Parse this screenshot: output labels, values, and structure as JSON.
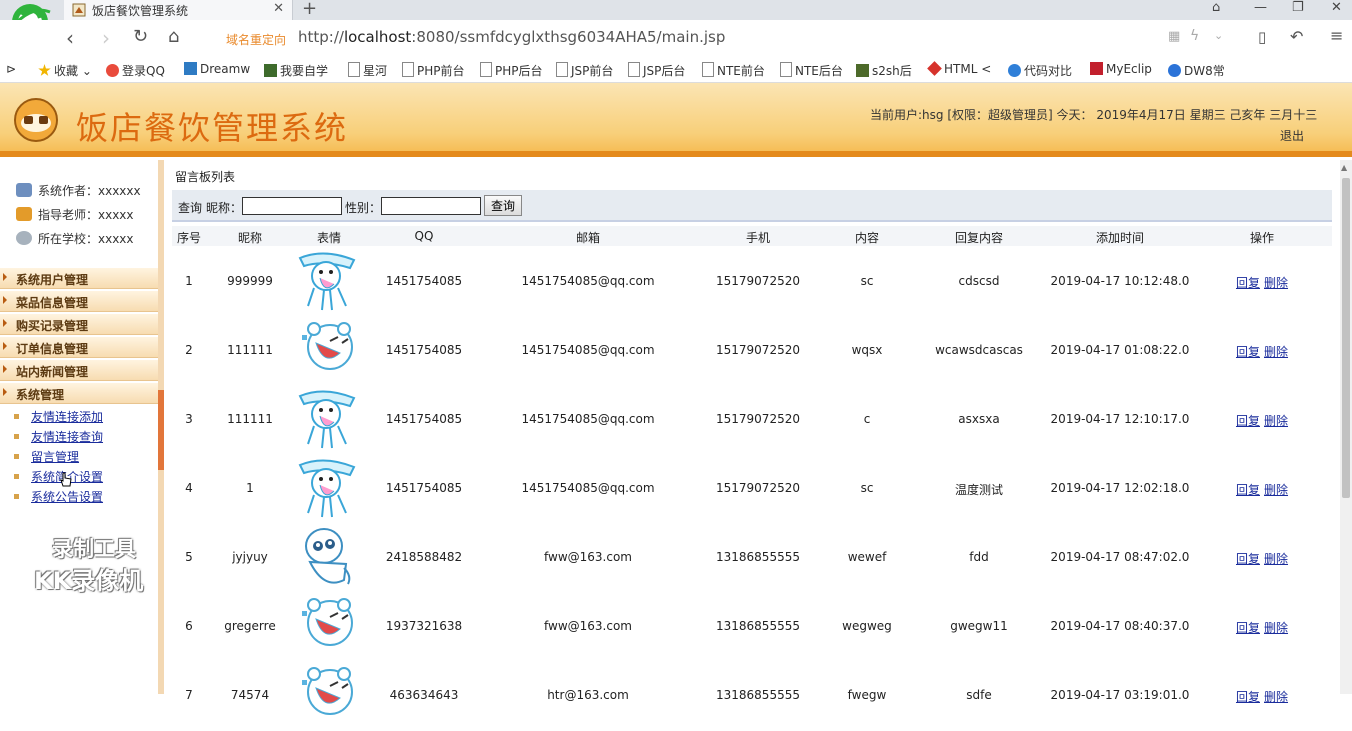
{
  "browser": {
    "tab_title": "饭店餐饮管理系统",
    "redirect_label": "域名重定向",
    "url_prefix": "http://",
    "url_host": "localhost",
    "url_rest": ":8080/ssmfdcyglxthsg6034AHA5/main.jsp",
    "bookmarks": [
      "收藏",
      "登录QQ",
      "Dreamw",
      "我要自学",
      "星河",
      "PHP前台",
      "PHP后台",
      "JSP前台",
      "JSP后台",
      "NTE前台",
      "NTE后台",
      "s2sh后",
      "HTML <",
      "代码对比",
      "MyEclip",
      "DW8常"
    ]
  },
  "header": {
    "title": "饭店餐饮管理系统",
    "user_info": "当前用户:hsg [权限：超级管理员] 今天： 2019年4月17日 星期三 己亥年 三月十三",
    "logout": "退出"
  },
  "sidebar": {
    "info": [
      "系统作者：xxxxxx",
      "指导老师：xxxxx",
      "所在学校：xxxxx"
    ],
    "menus": [
      "系统用户管理",
      "菜品信息管理",
      "购买记录管理",
      "订单信息管理",
      "站内新闻管理",
      "系统管理"
    ],
    "submenu": [
      "友情连接添加",
      "友情连接查询",
      "留言管理",
      "系统简介设置",
      "系统公告设置"
    ]
  },
  "watermark": {
    "line1": "录制工具",
    "line2": "KK录像机"
  },
  "content": {
    "panel_title": "留言板列表",
    "search": {
      "query_label": "查询",
      "nickname_label": "昵称：",
      "gender_label": "性别：",
      "button": "查询",
      "nickname_value": "",
      "gender_value": ""
    },
    "columns": [
      "序号",
      "昵称",
      "表情",
      "QQ",
      "邮箱",
      "手机",
      "内容",
      "回复内容",
      "添加时间",
      "操作"
    ],
    "actions": {
      "reply": "回复",
      "delete": "删除"
    },
    "rows": [
      {
        "no": "1",
        "nick": "999999",
        "avatar": "kite-doll",
        "qq": "1451754085",
        "email": "1451754085@qq.com",
        "phone": "15179072520",
        "content": "sc",
        "reply": "cdscsd",
        "time": "2019-04-17 10:12:48.0"
      },
      {
        "no": "2",
        "nick": "111111",
        "avatar": "laughing-bear",
        "qq": "1451754085",
        "email": "1451754085@qq.com",
        "phone": "15179072520",
        "content": "wqsx",
        "reply": "wcawsdcascas",
        "time": "2019-04-17 01:08:22.0"
      },
      {
        "no": "3",
        "nick": "111111",
        "avatar": "kite-doll",
        "qq": "1451754085",
        "email": "1451754085@qq.com",
        "phone": "15179072520",
        "content": "c",
        "reply": "asxsxa",
        "time": "2019-04-17 12:10:17.0"
      },
      {
        "no": "4",
        "nick": "1",
        "avatar": "kite-doll",
        "qq": "1451754085",
        "email": "1451754085@qq.com",
        "phone": "15179072520",
        "content": "sc",
        "reply": "温度测试",
        "time": "2019-04-17 12:02:18.0"
      },
      {
        "no": "5",
        "nick": "jyjyuy",
        "avatar": "sitting-doll",
        "qq": "2418588482",
        "email": "fww@163.com",
        "phone": "13186855555",
        "content": "wewef",
        "reply": "fdd",
        "time": "2019-04-17 08:47:02.0"
      },
      {
        "no": "6",
        "nick": "gregerre",
        "avatar": "laughing-bear",
        "qq": "1937321638",
        "email": "fww@163.com",
        "phone": "13186855555",
        "content": "wegweg",
        "reply": "gwegw11",
        "time": "2019-04-17 08:40:37.0"
      },
      {
        "no": "7",
        "nick": "74574",
        "avatar": "laughing-bear",
        "qq": "463634643",
        "email": "htr@163.com",
        "phone": "13186855555",
        "content": "fwegw",
        "reply": "sdfe",
        "time": "2019-04-17 03:19:01.0"
      }
    ]
  },
  "colors": {
    "accent": "#dc6a10",
    "link": "#1a2c9c",
    "header_bottom": "#e48a1c"
  }
}
